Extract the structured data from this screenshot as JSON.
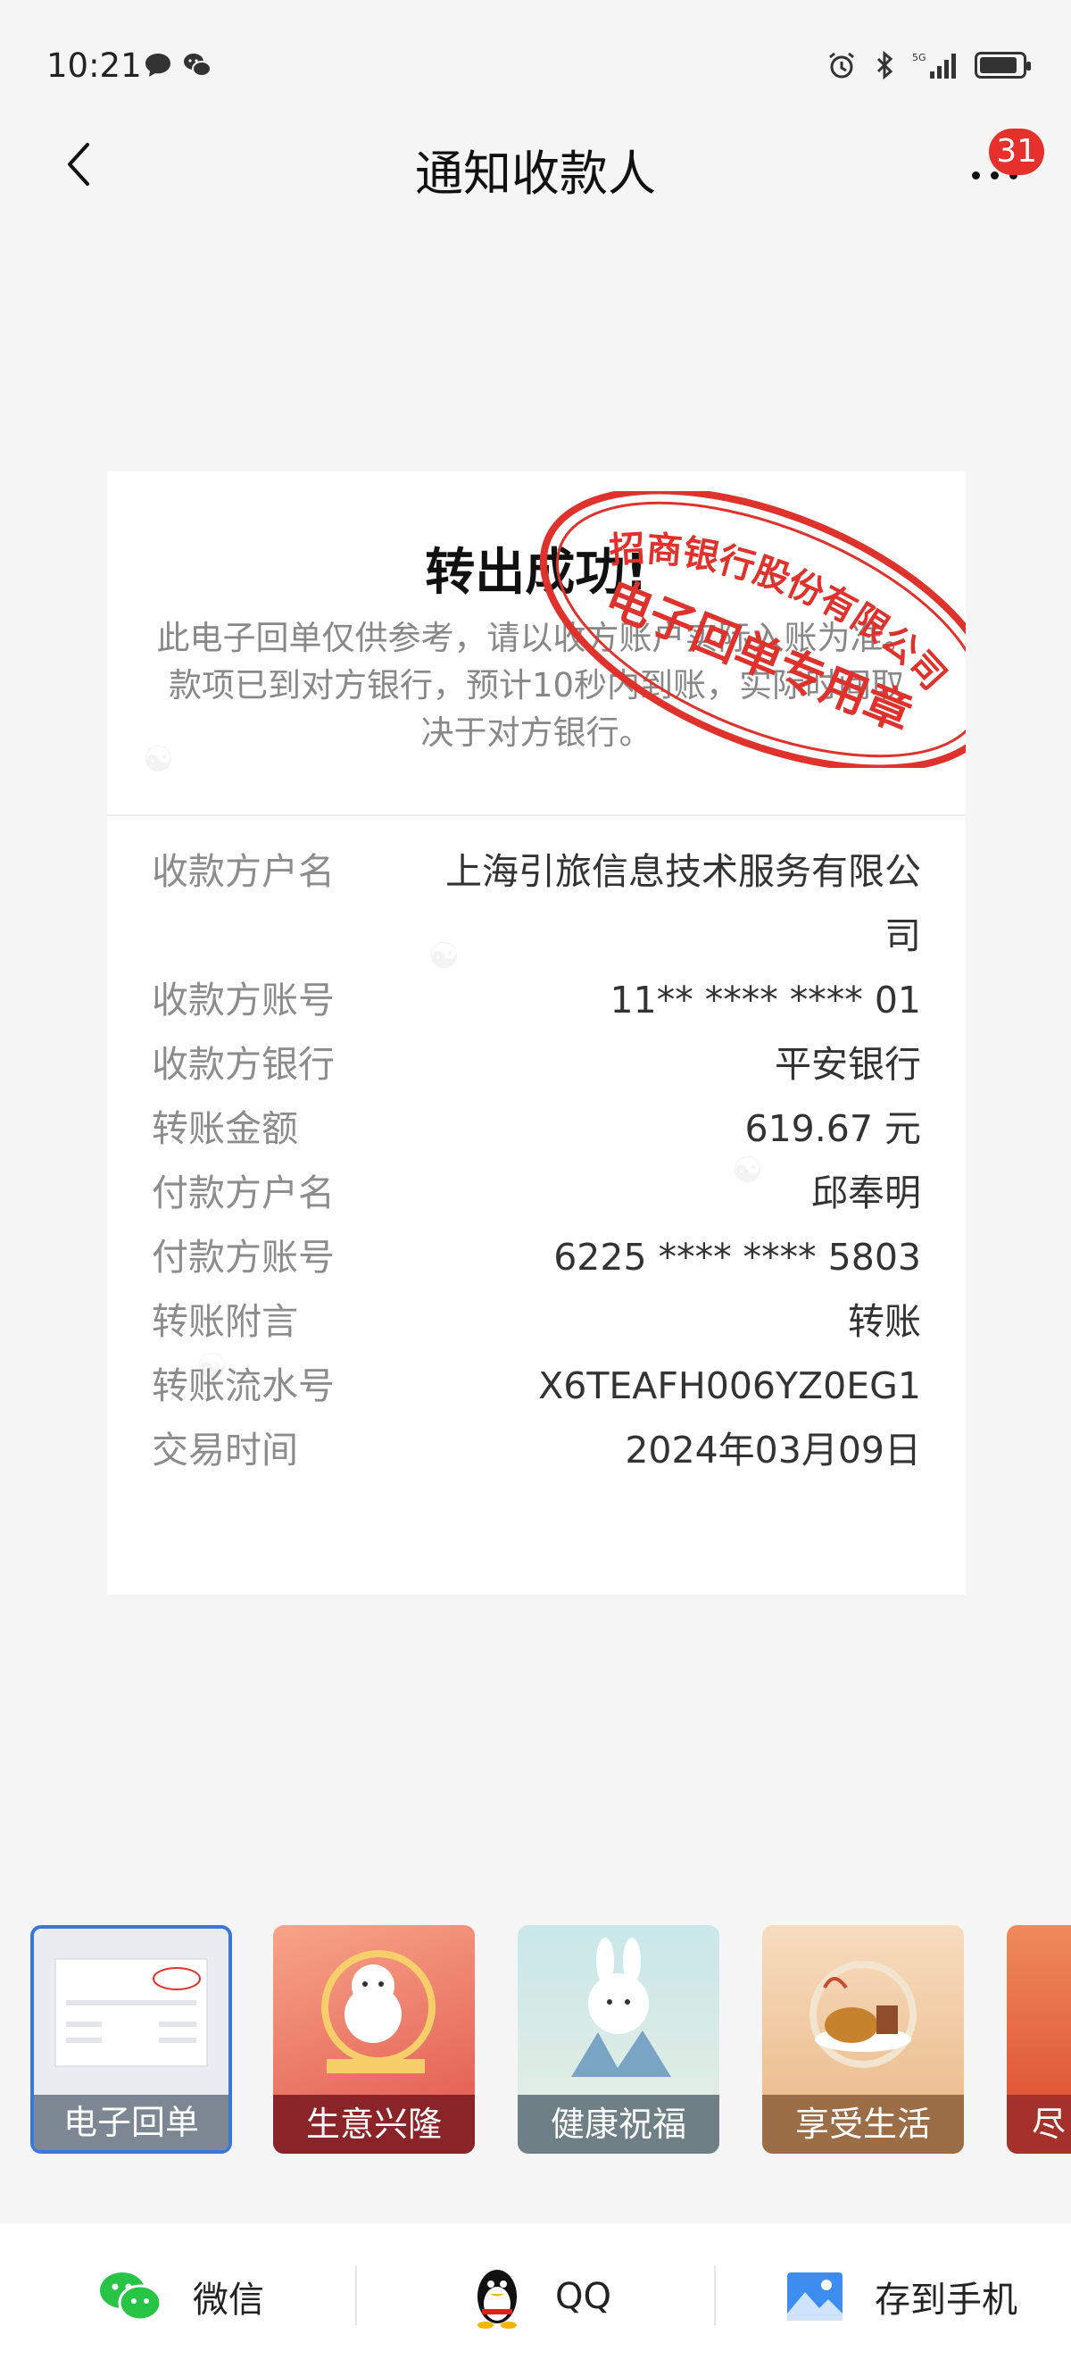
{
  "status": {
    "time": "10:21",
    "network": "5G"
  },
  "header": {
    "title": "通知收款人",
    "badge_count": "31"
  },
  "receipt": {
    "title": "转出成功!",
    "notice": "此电子回单仅供参考，请以收方账户实际入账为准。款项已到对方银行，预计10秒内到账，实际时间取决于对方银行。",
    "stamp_text_top": "招商银行股份有限公司",
    "stamp_text_bottom": "电子回单专用章",
    "rows": [
      {
        "label": "收款方户名",
        "value": "上海引旅信息技术服务有限公司"
      },
      {
        "label": "收款方账号",
        "value": "11** **** **** 01"
      },
      {
        "label": "收款方银行",
        "value": "平安银行"
      },
      {
        "label": "转账金额",
        "value": "619.67 元"
      },
      {
        "label": "付款方户名",
        "value": "邱奉明"
      },
      {
        "label": "付款方账号",
        "value": "6225 **** **** 5803"
      },
      {
        "label": "转账附言",
        "value": "转账"
      },
      {
        "label": "转账流水号",
        "value": "X6TEAFH006YZ0EG1"
      },
      {
        "label": "交易时间",
        "value": "2024年03月09日"
      }
    ]
  },
  "templates": [
    {
      "label": "电子回单",
      "selected": true
    },
    {
      "label": "生意兴隆"
    },
    {
      "label": "健康祝福"
    },
    {
      "label": "享受生活"
    },
    {
      "label": "尽"
    }
  ],
  "share": {
    "wechat": "微信",
    "qq": "QQ",
    "save": "存到手机"
  },
  "colors": {
    "stamp_red": "#e0322c",
    "badge_red": "#e5302c",
    "selected_border": "#3a78d8",
    "wechat_green": "#28c445"
  }
}
